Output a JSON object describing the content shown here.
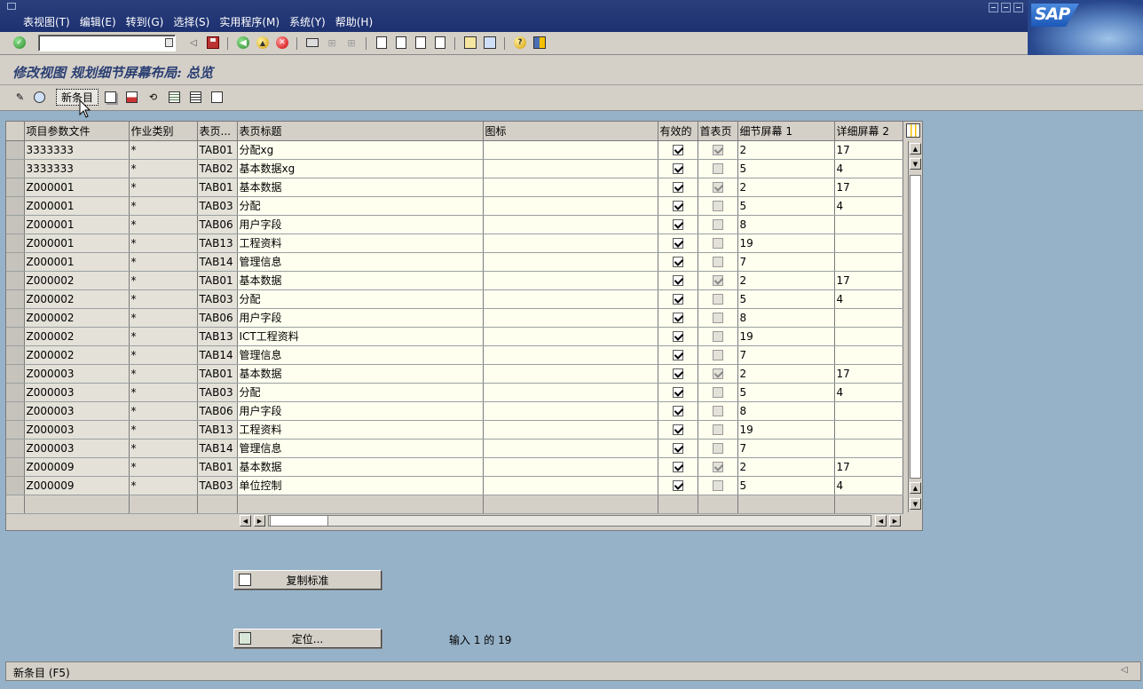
{
  "menu": [
    "表视图(T)",
    "编辑(E)",
    "转到(G)",
    "选择(S)",
    "实用程序(M)",
    "系统(Y)",
    "帮助(H)"
  ],
  "logo": "SAP",
  "page_title": "修改视图 规划细节屏幕布局: 总览",
  "toolbar2": {
    "new_entry": "新条目"
  },
  "table": {
    "headers": [
      "项目参数文件",
      "作业类别",
      "表页...",
      "表页标题",
      "图标",
      "有效的",
      "首表页",
      "细节屏幕 1",
      "详细屏幕 2"
    ],
    "rows": [
      {
        "profile": "3333333",
        "cat": "*",
        "tab": "TAB01",
        "title": "分配xg",
        "icon": "",
        "active": true,
        "first": true,
        "d1": "2",
        "d2": "17"
      },
      {
        "profile": "3333333",
        "cat": "*",
        "tab": "TAB02",
        "title": "基本数据xg",
        "icon": "",
        "active": true,
        "first": false,
        "d1": "5",
        "d2": "4"
      },
      {
        "profile": "Z000001",
        "cat": "*",
        "tab": "TAB01",
        "title": "基本数据",
        "icon": "",
        "active": true,
        "first": true,
        "d1": "2",
        "d2": "17"
      },
      {
        "profile": "Z000001",
        "cat": "*",
        "tab": "TAB03",
        "title": "分配",
        "icon": "",
        "active": true,
        "first": false,
        "d1": "5",
        "d2": "4"
      },
      {
        "profile": "Z000001",
        "cat": "*",
        "tab": "TAB06",
        "title": "用户字段",
        "icon": "",
        "active": true,
        "first": false,
        "d1": "8",
        "d2": ""
      },
      {
        "profile": "Z000001",
        "cat": "*",
        "tab": "TAB13",
        "title": "工程资料",
        "icon": "",
        "active": true,
        "first": false,
        "d1": "19",
        "d2": ""
      },
      {
        "profile": "Z000001",
        "cat": "*",
        "tab": "TAB14",
        "title": "管理信息",
        "icon": "",
        "active": true,
        "first": false,
        "d1": "7",
        "d2": ""
      },
      {
        "profile": "Z000002",
        "cat": "*",
        "tab": "TAB01",
        "title": "基本数据",
        "icon": "",
        "active": true,
        "first": true,
        "d1": "2",
        "d2": "17"
      },
      {
        "profile": "Z000002",
        "cat": "*",
        "tab": "TAB03",
        "title": "分配",
        "icon": "",
        "active": true,
        "first": false,
        "d1": "5",
        "d2": "4"
      },
      {
        "profile": "Z000002",
        "cat": "*",
        "tab": "TAB06",
        "title": "用户字段",
        "icon": "",
        "active": true,
        "first": false,
        "d1": "8",
        "d2": ""
      },
      {
        "profile": "Z000002",
        "cat": "*",
        "tab": "TAB13",
        "title": "ICT工程资料",
        "icon": "",
        "active": true,
        "first": false,
        "d1": "19",
        "d2": ""
      },
      {
        "profile": "Z000002",
        "cat": "*",
        "tab": "TAB14",
        "title": "管理信息",
        "icon": "",
        "active": true,
        "first": false,
        "d1": "7",
        "d2": ""
      },
      {
        "profile": "Z000003",
        "cat": "*",
        "tab": "TAB01",
        "title": "基本数据",
        "icon": "",
        "active": true,
        "first": true,
        "d1": "2",
        "d2": "17"
      },
      {
        "profile": "Z000003",
        "cat": "*",
        "tab": "TAB03",
        "title": "分配",
        "icon": "",
        "active": true,
        "first": false,
        "d1": "5",
        "d2": "4"
      },
      {
        "profile": "Z000003",
        "cat": "*",
        "tab": "TAB06",
        "title": "用户字段",
        "icon": "",
        "active": true,
        "first": false,
        "d1": "8",
        "d2": ""
      },
      {
        "profile": "Z000003",
        "cat": "*",
        "tab": "TAB13",
        "title": "工程资料",
        "icon": "",
        "active": true,
        "first": false,
        "d1": "19",
        "d2": ""
      },
      {
        "profile": "Z000003",
        "cat": "*",
        "tab": "TAB14",
        "title": "管理信息",
        "icon": "",
        "active": true,
        "first": false,
        "d1": "7",
        "d2": ""
      },
      {
        "profile": "Z000009",
        "cat": "*",
        "tab": "TAB01",
        "title": "基本数据",
        "icon": "",
        "active": true,
        "first": true,
        "d1": "2",
        "d2": "17"
      },
      {
        "profile": "Z000009",
        "cat": "*",
        "tab": "TAB03",
        "title": "单位控制",
        "icon": "",
        "active": true,
        "first": false,
        "d1": "5",
        "d2": "4"
      }
    ]
  },
  "buttons": {
    "copy_standard": "复制标准",
    "position": "定位..."
  },
  "entry_info": "输入 1 的 19",
  "status": {
    "message": "新条目   (F5)"
  },
  "icons": [
    "enter-icon",
    "back-icon",
    "exit-icon",
    "cancel-icon",
    "save-icon",
    "print-icon",
    "find-icon",
    "find-next-icon",
    "first-page-icon",
    "prev-page-icon",
    "next-page-icon",
    "last-page-icon",
    "new-session-icon",
    "shortcut-icon",
    "help-icon",
    "layout-icon",
    "edit-pencil-icon",
    "display-icon",
    "copy-icon",
    "delete-icon",
    "undo-icon",
    "select-all-icon",
    "select-block-icon",
    "deselect-all-icon"
  ]
}
